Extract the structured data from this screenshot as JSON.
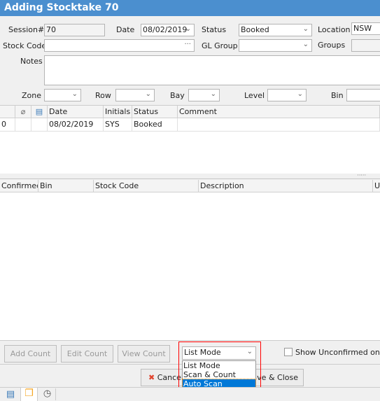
{
  "title": "Adding Stocktake 70",
  "form": {
    "session_label": "Session#",
    "session_value": "70",
    "date_label": "Date",
    "date_value": "08/02/2019",
    "status_label": "Status",
    "status_value": "Booked",
    "location_label": "Location",
    "location_value": "NSW",
    "stock_code_label": "Stock Code",
    "stock_code_value": "",
    "gl_group_label": "GL Group",
    "groups_label": "Groups",
    "notes_label": "Notes",
    "zone_label": "Zone",
    "row_label": "Row",
    "bay_label": "Bay",
    "level_label": "Level",
    "bin_label": "Bin"
  },
  "history_grid": {
    "columns": [
      "",
      "",
      "",
      "Date",
      "Initials",
      "Status",
      "Comment"
    ],
    "rows": [
      [
        "0",
        "",
        "",
        "08/02/2019",
        "SYS",
        "Booked",
        ""
      ]
    ]
  },
  "items_grid": {
    "columns": [
      "Confirmed",
      "Bin",
      "Stock Code",
      "Description",
      "U"
    ]
  },
  "buttons": {
    "add_count": "Add Count",
    "edit_count": "Edit Count",
    "view_count": "View Count",
    "cancel": "Cancel",
    "save_close": "Save & Close"
  },
  "mode_combo": {
    "value": "List Mode",
    "options": [
      "List Mode",
      "Scan & Count",
      "Auto Scan"
    ],
    "highlighted": "Auto Scan"
  },
  "show_unconfirmed": {
    "label": "Show Unconfirmed only",
    "checked": false
  },
  "colors": {
    "title_bar": "#4b8fcf",
    "highlight": "#0078d7",
    "annotation": "#ff0000"
  }
}
